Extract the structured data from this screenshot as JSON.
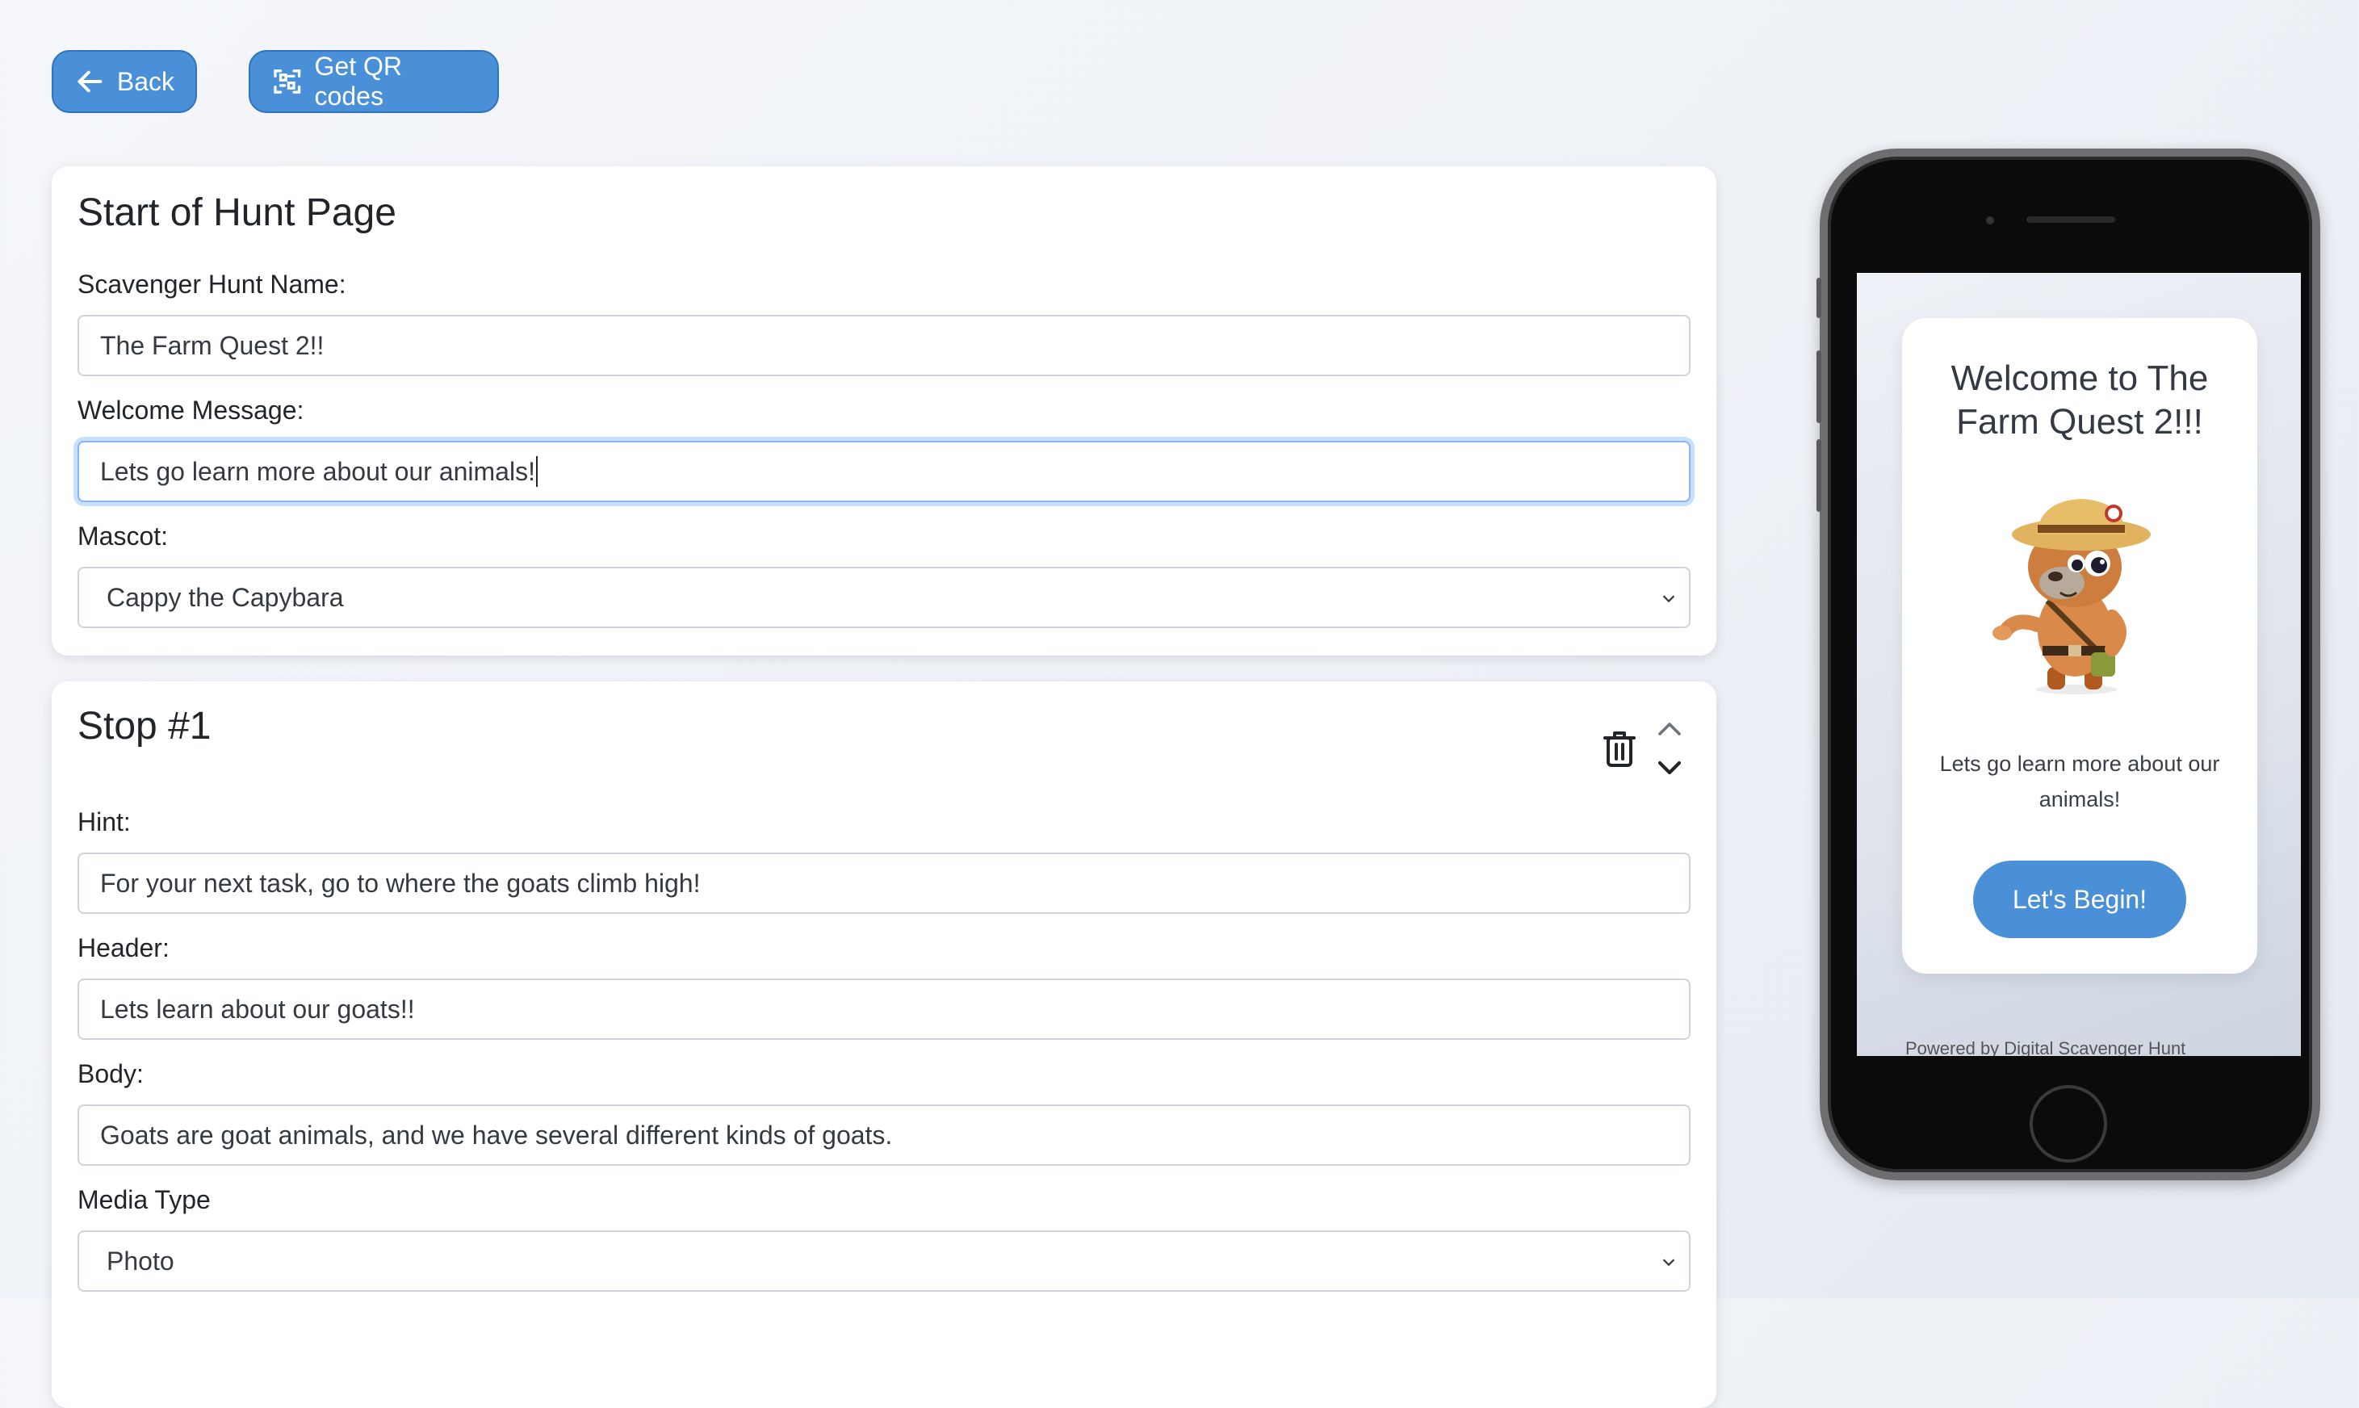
{
  "toolbar": {
    "back_label": "Back",
    "qr_label": "Get QR codes"
  },
  "start_page": {
    "title": "Start of Hunt Page",
    "hunt_name_label": "Scavenger Hunt Name:",
    "hunt_name_value": "The Farm Quest 2!!",
    "welcome_label": "Welcome Message:",
    "welcome_value": "Lets go learn more about our animals!",
    "mascot_label": "Mascot:",
    "mascot_value": "Cappy the Capybara"
  },
  "stop": {
    "title": "Stop #1",
    "hint_label": "Hint:",
    "hint_value": "For your next task, go to where the goats climb high!",
    "header_label": "Header:",
    "header_value": "Lets learn about our goats!!",
    "body_label": "Body:",
    "body_value": "Goats are goat animals, and we have several different kinds of goats.",
    "media_label": "Media Type",
    "media_value": "Photo"
  },
  "preview": {
    "title": "Welcome to The Farm Quest 2!!!",
    "message": "Lets go learn more about our animals!",
    "begin_label": "Let's Begin!",
    "footer": "Powered by Digital Scavenger Hunt"
  },
  "colors": {
    "accent": "#4a90d9",
    "page_bg": "#eef1f6"
  }
}
